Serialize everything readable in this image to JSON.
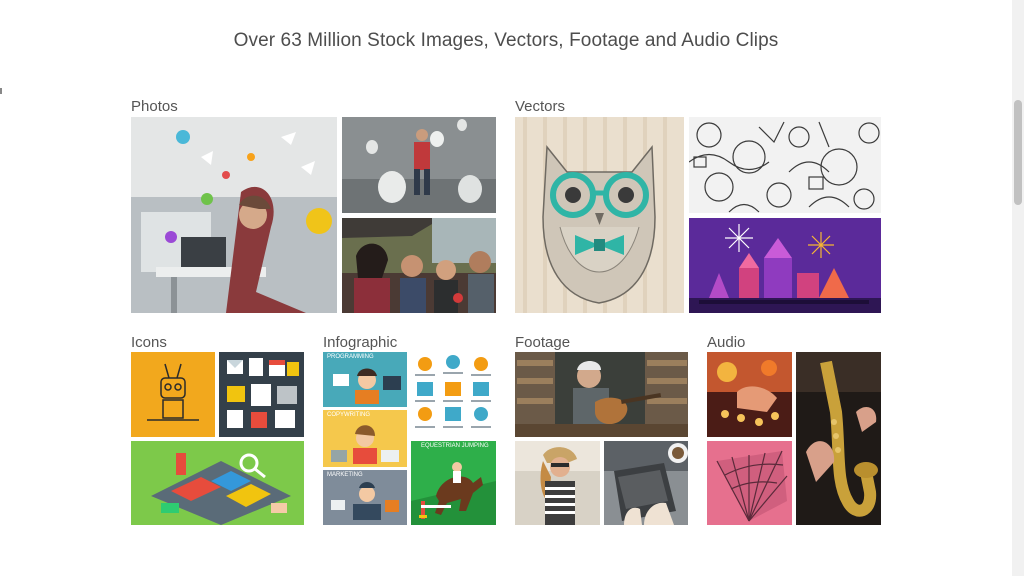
{
  "headline": "Over 63 Million Stock Images, Vectors, Footage and Audio Clips",
  "categories": {
    "photos": "Photos",
    "vectors": "Vectors",
    "icons": "Icons",
    "infographic": "Infographic",
    "footage": "Footage",
    "audio": "Audio"
  },
  "infographic_labels": {
    "programming": "PROGRAMMING",
    "copywriting": "COPYWRITING",
    "marketing": "MARKETING",
    "equestrian": "EQUESTRIAN JUMPING"
  }
}
